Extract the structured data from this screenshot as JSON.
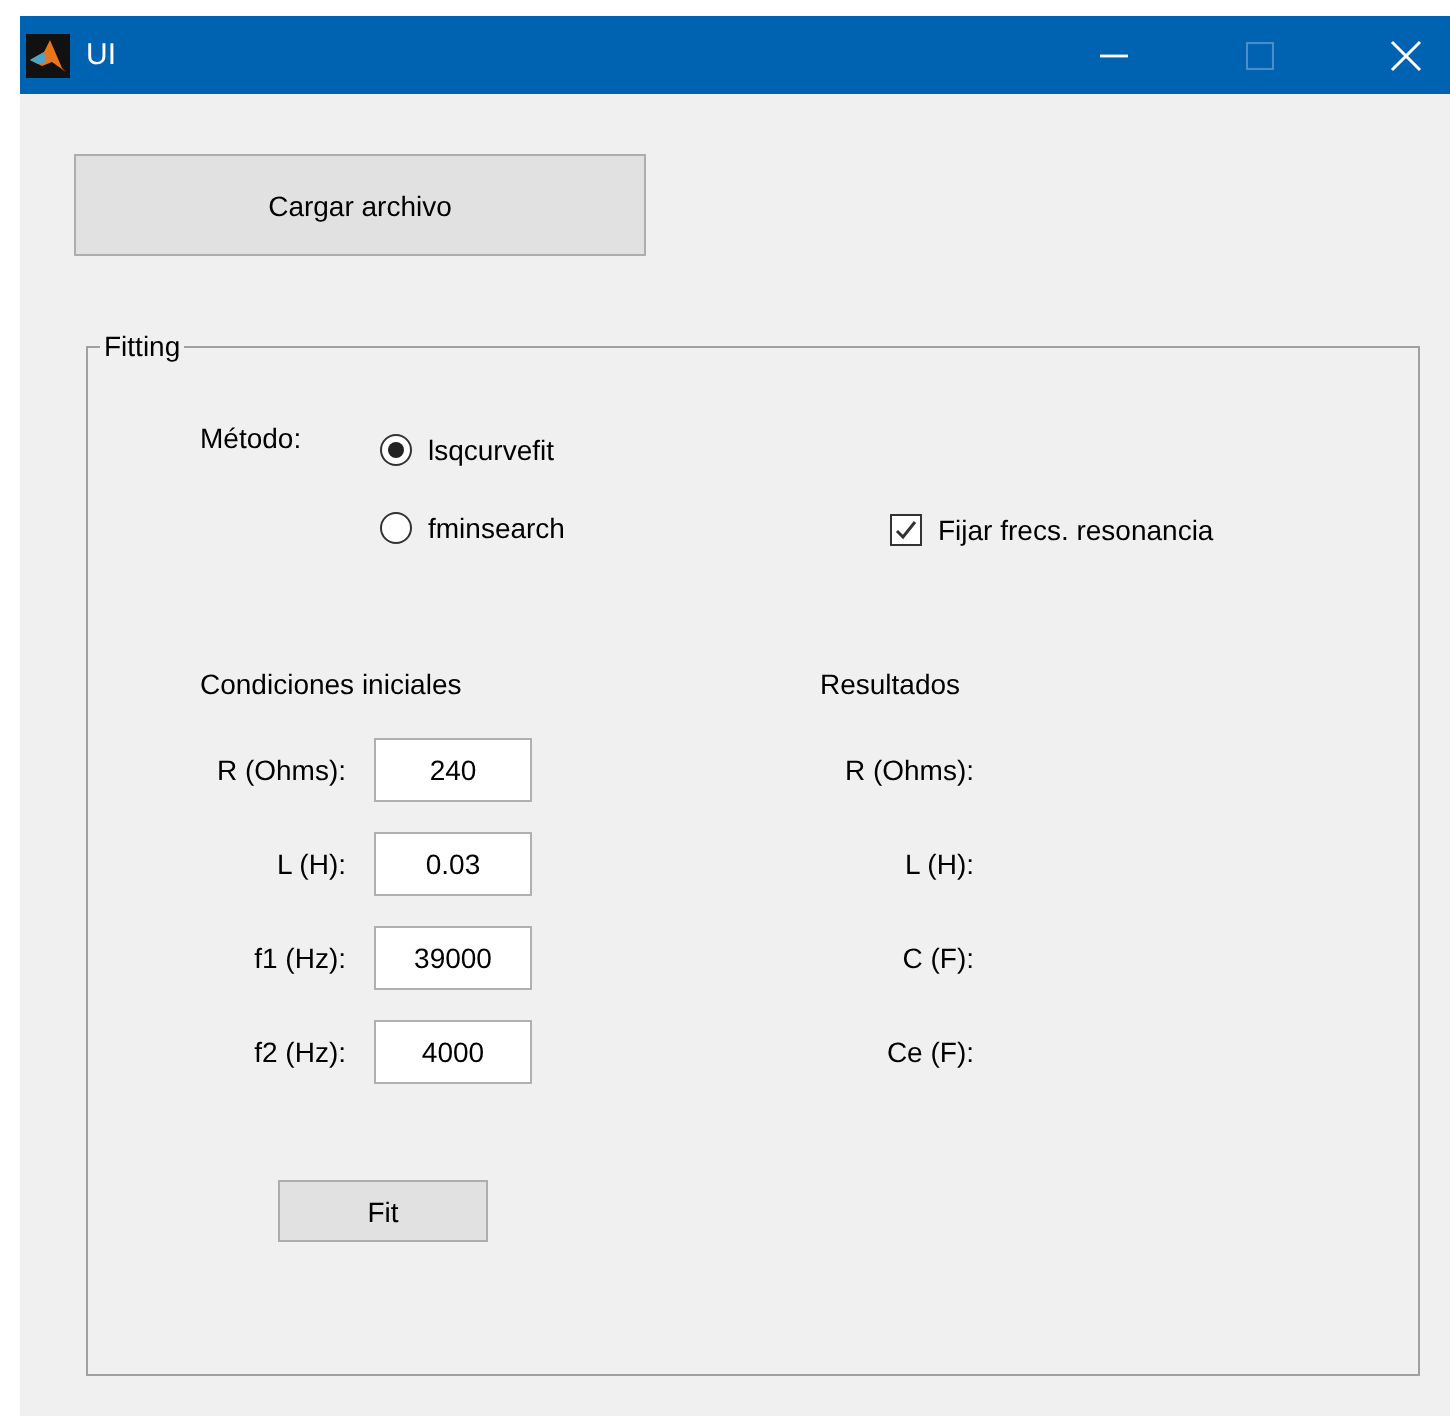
{
  "window": {
    "title": "UI"
  },
  "load_button": "Cargar archivo",
  "fitting": {
    "title": "Fitting",
    "method_label": "Método:",
    "methods": [
      {
        "label": "lsqcurvefit",
        "selected": true
      },
      {
        "label": "fminsearch",
        "selected": false
      }
    ],
    "fix_checkbox": {
      "label": "Fijar frecs. resonancia",
      "checked": true
    },
    "initial": {
      "heading": "Condiciones iniciales",
      "fields": [
        {
          "label": "R (Ohms):",
          "value": "240"
        },
        {
          "label": "L (H):",
          "value": "0.03"
        },
        {
          "label": "f1 (Hz):",
          "value": "39000"
        },
        {
          "label": "f2 (Hz):",
          "value": "4000"
        }
      ]
    },
    "results": {
      "heading": "Resultados",
      "labels": [
        "R (Ohms):",
        "L (H):",
        "C (F):",
        "Ce (F):"
      ]
    },
    "fit_button": "Fit"
  }
}
